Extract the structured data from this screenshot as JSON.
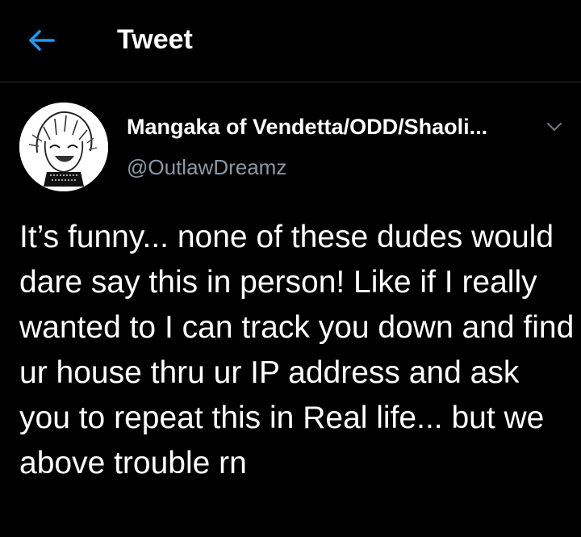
{
  "header": {
    "title": "Tweet",
    "back_icon": "arrow-left-icon",
    "accent_color": "#1d9bf0"
  },
  "author": {
    "name": "Mangaka of Vendetta/ODD/Shaoli...",
    "handle": "@OutlawDreamz",
    "avatar_icon": "manga-character-avatar"
  },
  "menu": {
    "icon": "chevron-down-icon"
  },
  "tweet": {
    "text": "It’s funny... none of these dudes would dare say this in person! Like if I really wanted to I can track you down and find ur house thru ur IP address and ask you to repeat this in Real life... but we above trouble rn"
  },
  "colors": {
    "background": "#000000",
    "text": "#ffffff",
    "secondary_text": "#8b98a5",
    "divider": "#2f3336"
  }
}
